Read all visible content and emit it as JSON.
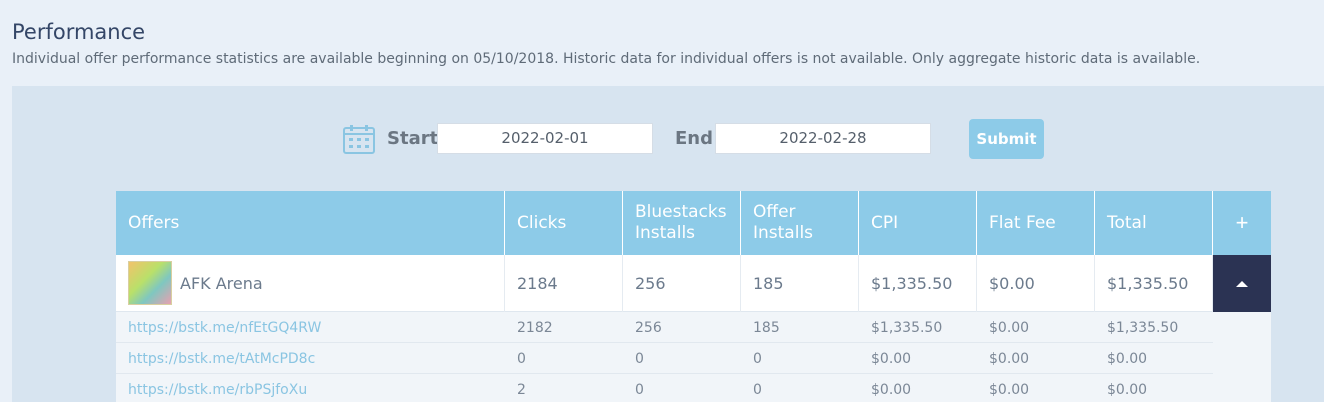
{
  "page": {
    "title": "Performance",
    "description": "Individual offer performance statistics are available beginning on 05/10/2018. Historic data for individual offers is not available. Only aggregate historic data is available."
  },
  "filters": {
    "calendar_icon": "calendar-icon",
    "start_label": "Start",
    "start_value": "2022-02-01",
    "end_label": "End",
    "end_value": "2022-02-28",
    "submit_label": "Submit"
  },
  "table": {
    "headers": [
      "Offers",
      "Clicks",
      "Bluestacks Installs",
      "Offer Installs",
      "CPI",
      "Flat Fee",
      "Total"
    ],
    "expand_icon": "+",
    "main_row": {
      "offer": "AFK Arena",
      "clicks": "2184",
      "bluestacks_installs": "256",
      "offer_installs": "185",
      "cpi": "$1,335.50",
      "flat_fee": "$0.00",
      "total": "$1,335.50"
    },
    "sub_rows": [
      {
        "link": "https://bstk.me/nfEtGQ4RW",
        "clicks": "2182",
        "bluestacks_installs": "256",
        "offer_installs": "185",
        "cpi": "$1,335.50",
        "flat_fee": "$0.00",
        "total": "$1,335.50"
      },
      {
        "link": "https://bstk.me/tAtMcPD8c",
        "clicks": "0",
        "bluestacks_installs": "0",
        "offer_installs": "0",
        "cpi": "$0.00",
        "flat_fee": "$0.00",
        "total": "$0.00"
      },
      {
        "link": "https://bstk.me/rbPSjfoXu",
        "clicks": "2",
        "bluestacks_installs": "0",
        "offer_installs": "0",
        "cpi": "$0.00",
        "flat_fee": "$0.00",
        "total": "$0.00"
      }
    ]
  },
  "colors": {
    "header_bg": "#8dcbe8",
    "collapse_bg": "#2b3353",
    "link": "#8ac5e2",
    "panel_bg": "#d7e4f0"
  }
}
